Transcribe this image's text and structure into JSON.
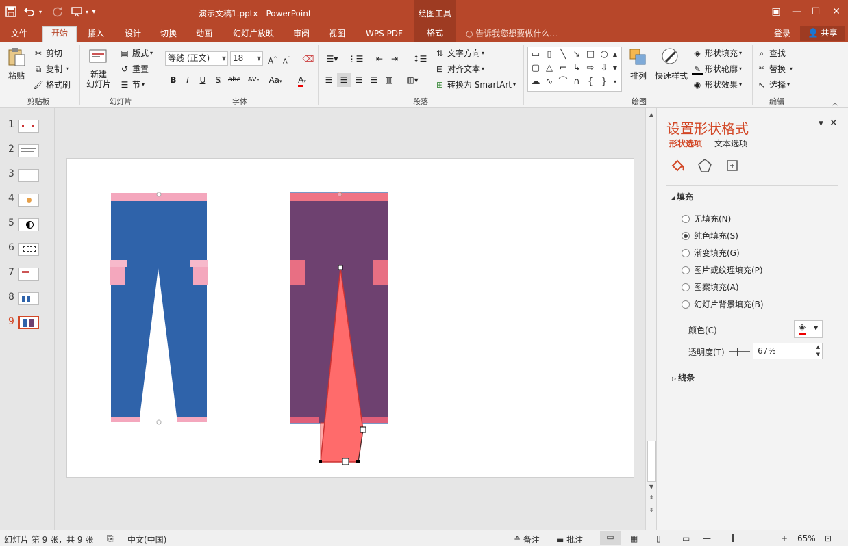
{
  "titlebar": {
    "doc_title": "演示文稿1.pptx - PowerPoint",
    "context_group": "绘图工具",
    "save_icon": "save-icon",
    "undo_icon": "undo-icon",
    "redo_icon": "redo-icon",
    "present_icon": "slideshow-from-start-icon",
    "qat_dropdown": "▾",
    "ribbon_display": "▣",
    "minimize": "—",
    "maximize": "☐",
    "close": "✕"
  },
  "tabs": [
    "文件",
    "开始",
    "插入",
    "设计",
    "切换",
    "动画",
    "幻灯片放映",
    "审阅",
    "视图",
    "WPS PDF",
    "格式"
  ],
  "active_tab": "开始",
  "tell_me": "告诉我您想要做什么...",
  "account": {
    "login": "登录",
    "share": "共享"
  },
  "ribbon": {
    "clipboard": {
      "label": "剪贴板",
      "paste": "粘贴",
      "cut": "剪切",
      "copy": "复制",
      "format_painter": "格式刷"
    },
    "slides": {
      "label": "幻灯片",
      "new_slide_line1": "新建",
      "new_slide_line2": "幻灯片",
      "layout": "版式",
      "reset": "重置",
      "section": "节"
    },
    "font": {
      "label": "字体",
      "font_name": "等线 (正文)",
      "font_size": "18",
      "bold": "B",
      "italic": "I",
      "underline": "U",
      "shadow": "S",
      "strike": "abc",
      "spacing": "AV",
      "case": "Aa",
      "grow": "A",
      "shrink": "A"
    },
    "paragraph": {
      "label": "段落",
      "text_direction": "文字方向",
      "align_text": "对齐文本",
      "smartart": "转换为 SmartArt"
    },
    "drawing": {
      "label": "绘图",
      "arrange": "排列",
      "quick_styles": "快速样式",
      "shape_fill": "形状填充",
      "shape_outline": "形状轮廓",
      "shape_effects": "形状效果"
    },
    "editing": {
      "label": "编辑",
      "find": "查找",
      "replace": "替换",
      "select": "选择"
    }
  },
  "slides_panel": {
    "numbers": [
      "1",
      "2",
      "3",
      "4",
      "5",
      "6",
      "7",
      "8",
      "9"
    ],
    "selected": 9
  },
  "format_pane": {
    "title": "设置形状格式",
    "tab_shape": "形状选项",
    "tab_text": "文本选项",
    "fill_section": "填充",
    "fill_options": [
      "无填充(N)",
      "纯色填充(S)",
      "渐变填充(G)",
      "图片或纹理填充(P)",
      "图案填充(A)",
      "幻灯片背景填充(B)"
    ],
    "fill_selected": 1,
    "color_label": "颜色(C)",
    "transparency_label": "透明度(T)",
    "transparency_value": "67%",
    "line_section": "线条",
    "accent": "#d24726"
  },
  "statusbar": {
    "slide_info": "幻灯片 第 9 张，共 9 张",
    "language": "中文(中国)",
    "notes": "备注",
    "comments": "批注",
    "zoom": "65%"
  },
  "colors": {
    "brand": "#b7472a",
    "jeans_blue": "#2f63aa",
    "pink": "#f4a7bd",
    "purple": "#6e4170",
    "coral": "#ff6b6b"
  }
}
